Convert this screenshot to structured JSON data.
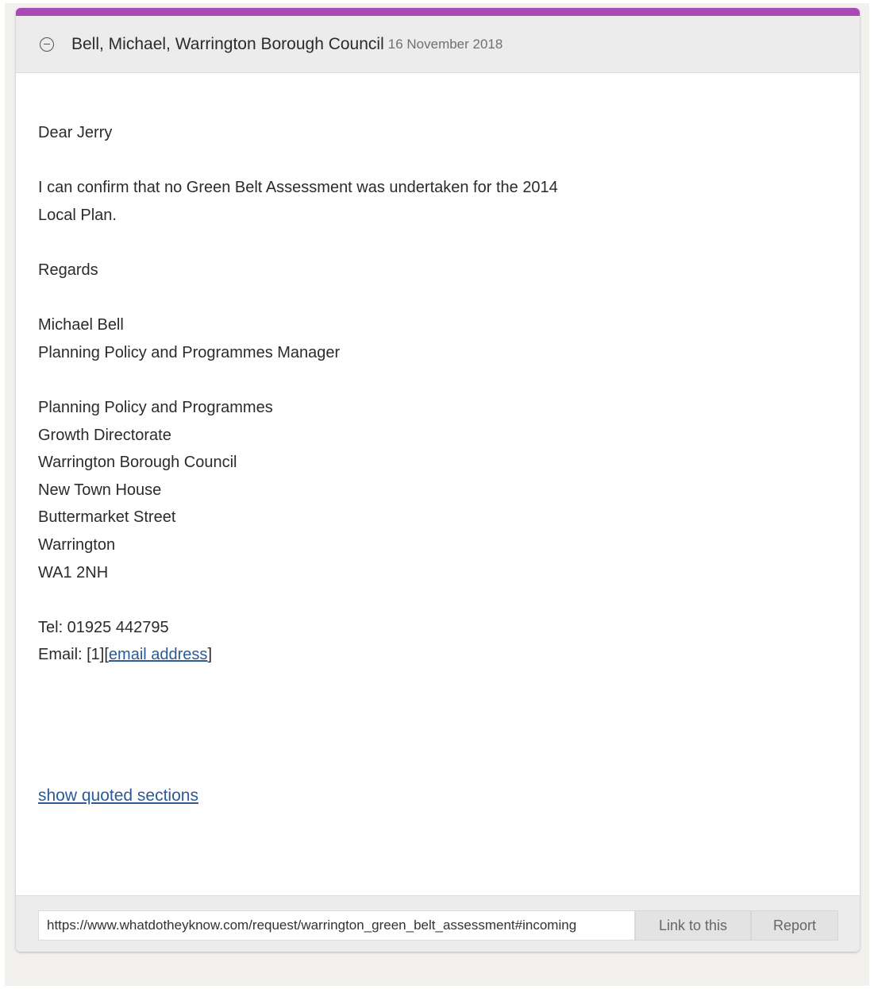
{
  "message": {
    "accent_color": "#a84ab3",
    "header": {
      "sender": "Bell, Michael, Warrington Borough Council",
      "date": "16 November 2018"
    },
    "greeting": "Dear Jerry",
    "body_lines": [
      "I can confirm that no Green Belt Assessment was undertaken for the 2014",
      "Local Plan."
    ],
    "sign_off": "Regards",
    "signature": {
      "name": "Michael Bell",
      "title": "Planning Policy and Programmes Manager"
    },
    "address_lines": [
      "Planning Policy and Programmes",
      "Growth Directorate",
      "Warrington Borough Council",
      "New Town House",
      "Buttermarket Street",
      "Warrington",
      "WA1 2NH"
    ],
    "contact": {
      "tel": "Tel: 01925 442795",
      "email_prefix": "Email: [1][",
      "email_link": "email address",
      "email_suffix": "]"
    },
    "show_quoted_label": "show quoted sections"
  },
  "footer": {
    "url_value": "https://www.whatdotheyknow.com/request/warrington_green_belt_assessment#incoming",
    "link_to_this_label": "Link to this",
    "report_label": "Report"
  }
}
